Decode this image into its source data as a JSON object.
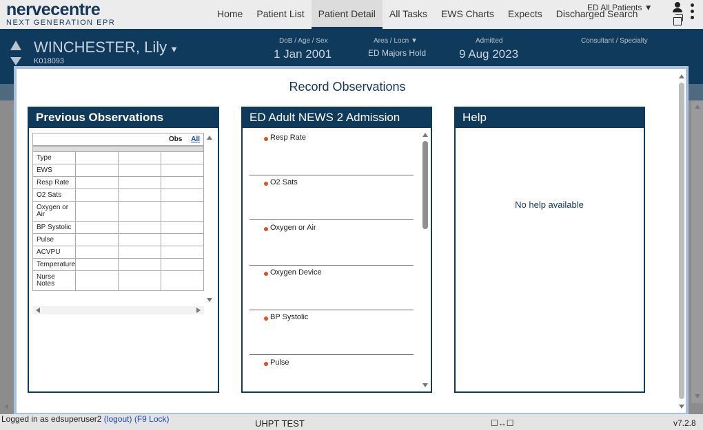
{
  "app": {
    "logo_main": "nervecentre",
    "logo_sub": "NEXT GENERATION EPR"
  },
  "nav": {
    "items": [
      "Home",
      "Patient List",
      "Patient Detail",
      "All Tasks",
      "EWS Charts",
      "Expects",
      "Discharged"
    ],
    "active": "Patient Detail",
    "patients_select": "ED All Patients ▼",
    "search": "Search"
  },
  "patient": {
    "name": "WINCHESTER, Lily",
    "id": "K018093",
    "dob_label": "DoB / Age / Sex",
    "dob_value": "1 Jan 2001",
    "area_label": "Area / Locn",
    "area_value": "ED Majors Hold",
    "admitted_label": "Admitted",
    "admitted_value": "9 Aug 2023",
    "consultant_label": "Consultant / Specialty"
  },
  "modal": {
    "title": "Record Observations",
    "previous": {
      "header": "Previous Observations",
      "obs_label": "Obs",
      "all_link": "All",
      "rows": [
        "Type",
        "EWS",
        "Resp Rate",
        "O2 Sats",
        "Oxygen or Air",
        "BP Systolic",
        "Pulse",
        "ACVPU",
        "Temperature",
        "Nurse Notes"
      ]
    },
    "news": {
      "header": "ED Adult NEWS 2 Admission",
      "items": [
        "Resp Rate",
        "O2 Sats",
        "Oxygen or Air",
        "Oxygen Device",
        "BP Systolic",
        "Pulse"
      ]
    },
    "help": {
      "header": "Help",
      "text": "No help available"
    }
  },
  "footer": {
    "login_prefix": "Logged in as edsuperuser2",
    "logout": "(logout)",
    "lock": "(F9 Lock)",
    "env": "UHPT TEST",
    "swap": "☐↔☐",
    "version": "v7.2.8"
  },
  "colors": {
    "brand": "#0f3a5c",
    "accent_dot": "#e4501b",
    "link": "#1a47c4"
  }
}
